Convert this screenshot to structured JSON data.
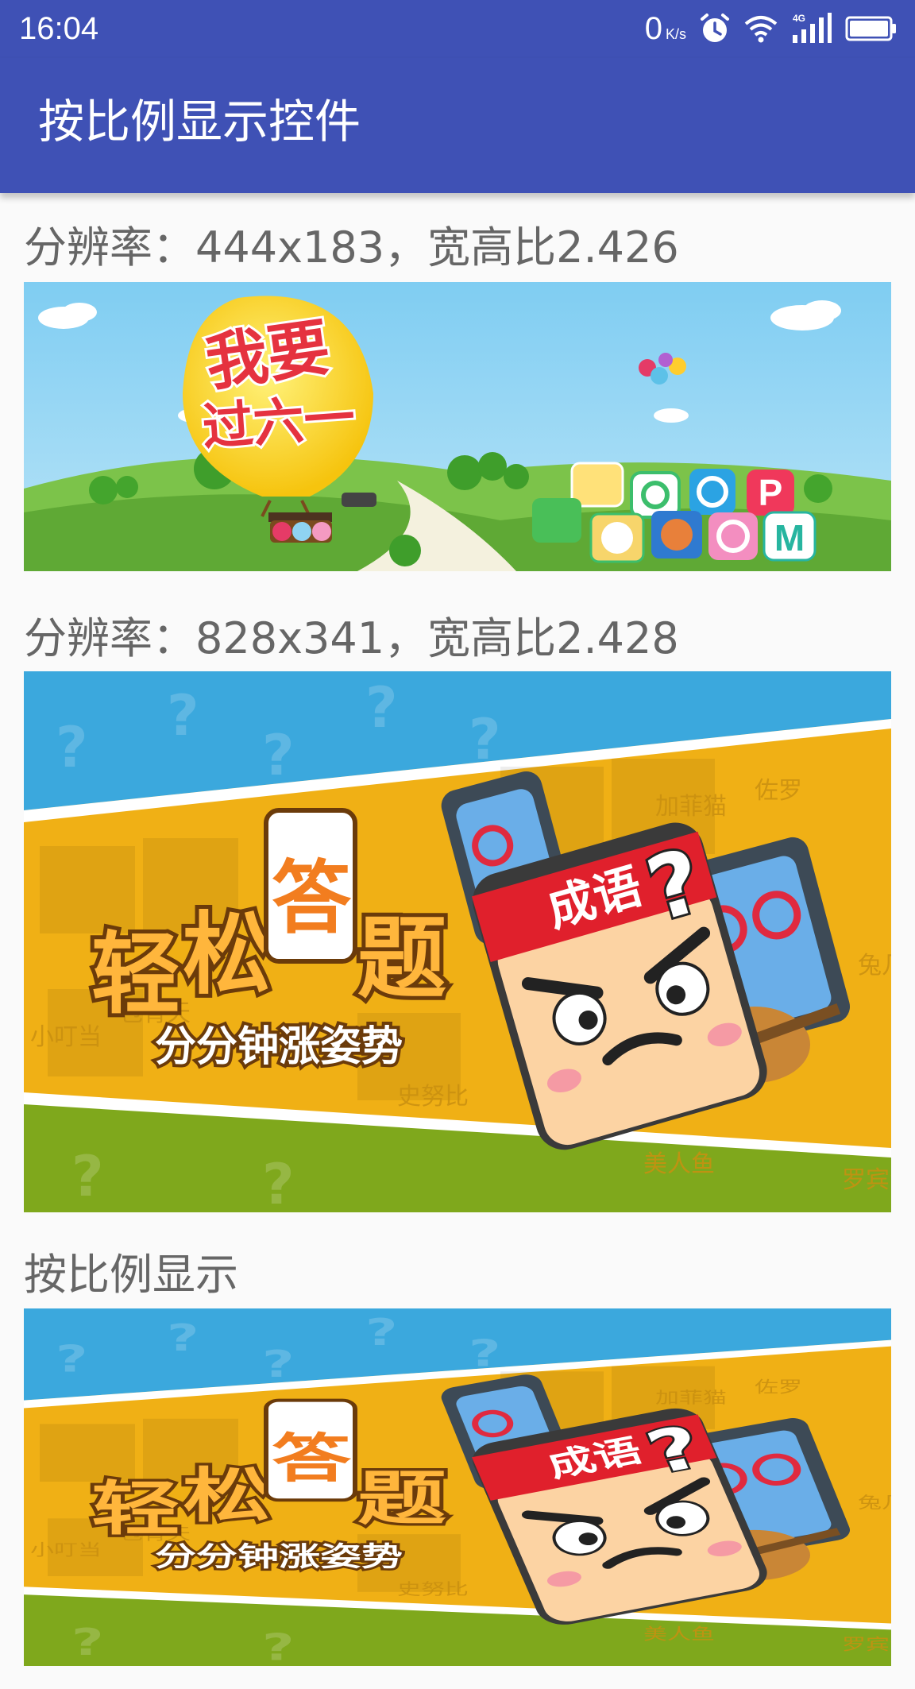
{
  "status_bar": {
    "time": "16:04",
    "net_speed": "0",
    "net_speed_unit": "K/s",
    "icons": [
      "alarm-icon",
      "wifi-icon",
      "signal-4g-icon",
      "battery-icon"
    ]
  },
  "app_bar": {
    "title": "按比例显示控件"
  },
  "sections": [
    {
      "caption": "分辨率：444x183，宽高比2.426",
      "banner": {
        "title_text": "我要过六一",
        "app_icon_labels": [
          "P",
          "M"
        ]
      }
    },
    {
      "caption": "分辨率：828x341，宽高比2.428",
      "banner": {
        "title_chars": [
          "轻",
          "松",
          "答",
          "题"
        ],
        "subtitle": "分分钟涨姿势",
        "headband": "成语",
        "question_mark": "?",
        "tile_words": [
          "小叮当",
          "包青天",
          "加菲猫",
          "佐罗",
          "兔八",
          "史努比",
          "罗宾汉",
          "美人鱼",
          "兔几"
        ]
      }
    },
    {
      "caption": "按比例显示",
      "banner": {
        "title_chars": [
          "轻",
          "松",
          "答",
          "题"
        ],
        "subtitle": "分分钟涨姿势",
        "headband": "成语",
        "question_mark": "?",
        "tile_words": [
          "小叮当",
          "包青天",
          "加菲猫",
          "佐罗",
          "兔八",
          "史努比",
          "罗宾汉",
          "美人鱼",
          "兔几"
        ]
      }
    }
  ],
  "colors": {
    "primary": "#3f51b5",
    "caption_text": "#666666",
    "background": "#fafafa"
  }
}
